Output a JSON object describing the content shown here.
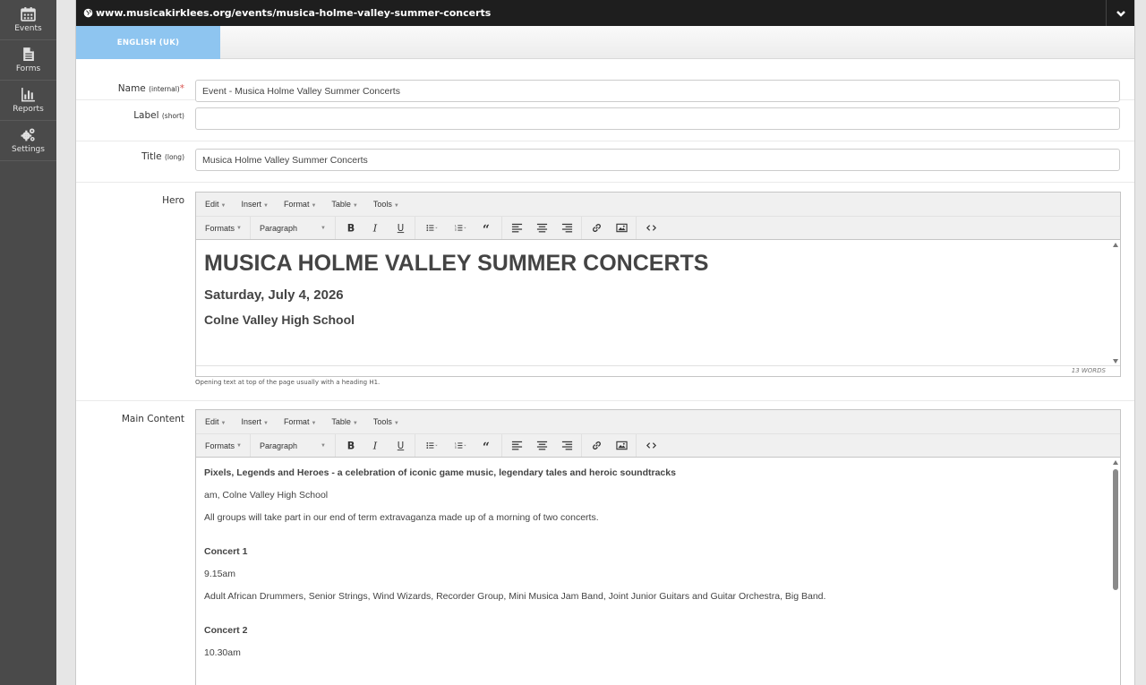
{
  "sidebar": {
    "items": [
      {
        "label": "Events",
        "icon": "calendar-icon"
      },
      {
        "label": "Forms",
        "icon": "document-icon"
      },
      {
        "label": "Reports",
        "icon": "bar-chart-icon"
      },
      {
        "label": "Settings",
        "icon": "gears-icon"
      }
    ]
  },
  "header": {
    "url": "www.musicakirklees.org/events/musica-holme-valley-summer-concerts"
  },
  "language_tab": "ENGLISH (UK)",
  "fields": {
    "name": {
      "label": "Name",
      "qualifier": "(internal)",
      "required_mark": "*",
      "value": "Event - Musica Holme Valley Summer Concerts"
    },
    "label": {
      "label": "Label",
      "qualifier": "(short)",
      "value": ""
    },
    "title": {
      "label": "Title",
      "qualifier": "(long)",
      "value": "Musica Holme Valley Summer Concerts"
    }
  },
  "editor_menu": {
    "edit": "Edit",
    "insert": "Insert",
    "format": "Format",
    "table": "Table",
    "tools": "Tools"
  },
  "editor_toolbar": {
    "formats": "Formats",
    "paragraph": "Paragraph"
  },
  "hero": {
    "label": "Hero",
    "heading1": "MUSICA HOLME VALLEY SUMMER CONCERTS",
    "heading2": "Saturday, July 4, 2026",
    "heading3": "Colne Valley High School",
    "word_count": "13 WORDS",
    "help_text": "Opening text at top of the page usually with a heading H1."
  },
  "main_content": {
    "label": "Main Content",
    "p1": "Pixels, Legends and Heroes - a celebration of iconic game music, legendary tales and heroic soundtracks",
    "p2": "am, Colne Valley High School",
    "p3": "All groups will take part in our end of term extravaganza made up of a morning of two concerts.",
    "concert1_title": "Concert 1",
    "concert1_time": "9.15am",
    "concert1_groups": "Adult African Drummers, Senior Strings, Wind Wizards, Recorder Group, Mini Musica Jam Band, Joint Junior Guitars and Guitar Orchestra, Big Band.",
    "concert2_title": "Concert 2",
    "concert2_time": "10.30am"
  }
}
